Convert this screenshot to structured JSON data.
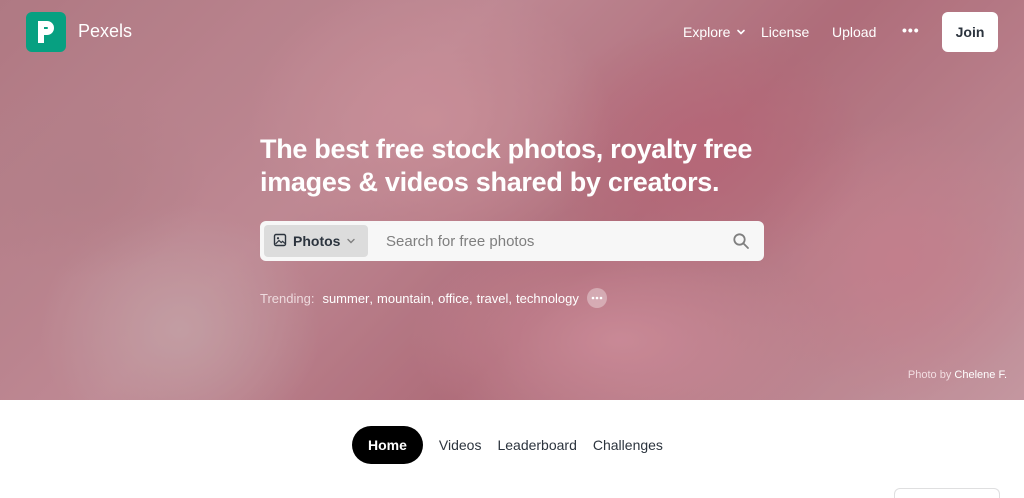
{
  "brand": {
    "name": "Pexels",
    "color": "#07a081"
  },
  "nav": {
    "explore": "Explore",
    "license": "License",
    "upload": "Upload",
    "more": "•••",
    "join": "Join"
  },
  "hero": {
    "headline_line1": "The best free stock photos, royalty free",
    "headline_line2": "images & videos shared by creators.",
    "search": {
      "type_label": "Photos",
      "placeholder": "Search for free photos",
      "value": ""
    },
    "trending": {
      "label": "Trending:",
      "items": [
        "summer",
        "mountain",
        "office",
        "travel",
        "technology"
      ]
    },
    "credit": {
      "prefix": "Photo by",
      "name": "Chelene F."
    }
  },
  "tabs": [
    {
      "label": "Home",
      "active": true
    },
    {
      "label": "Videos",
      "active": false
    },
    {
      "label": "Leaderboard",
      "active": false
    },
    {
      "label": "Challenges",
      "active": false
    }
  ],
  "icons": {
    "logo": "pexels-logo-icon",
    "explore_chevron": "chevron-down-icon",
    "type_image": "image-icon",
    "type_chevron": "chevron-down-icon",
    "search": "search-icon",
    "trending_more": "more-icon"
  }
}
